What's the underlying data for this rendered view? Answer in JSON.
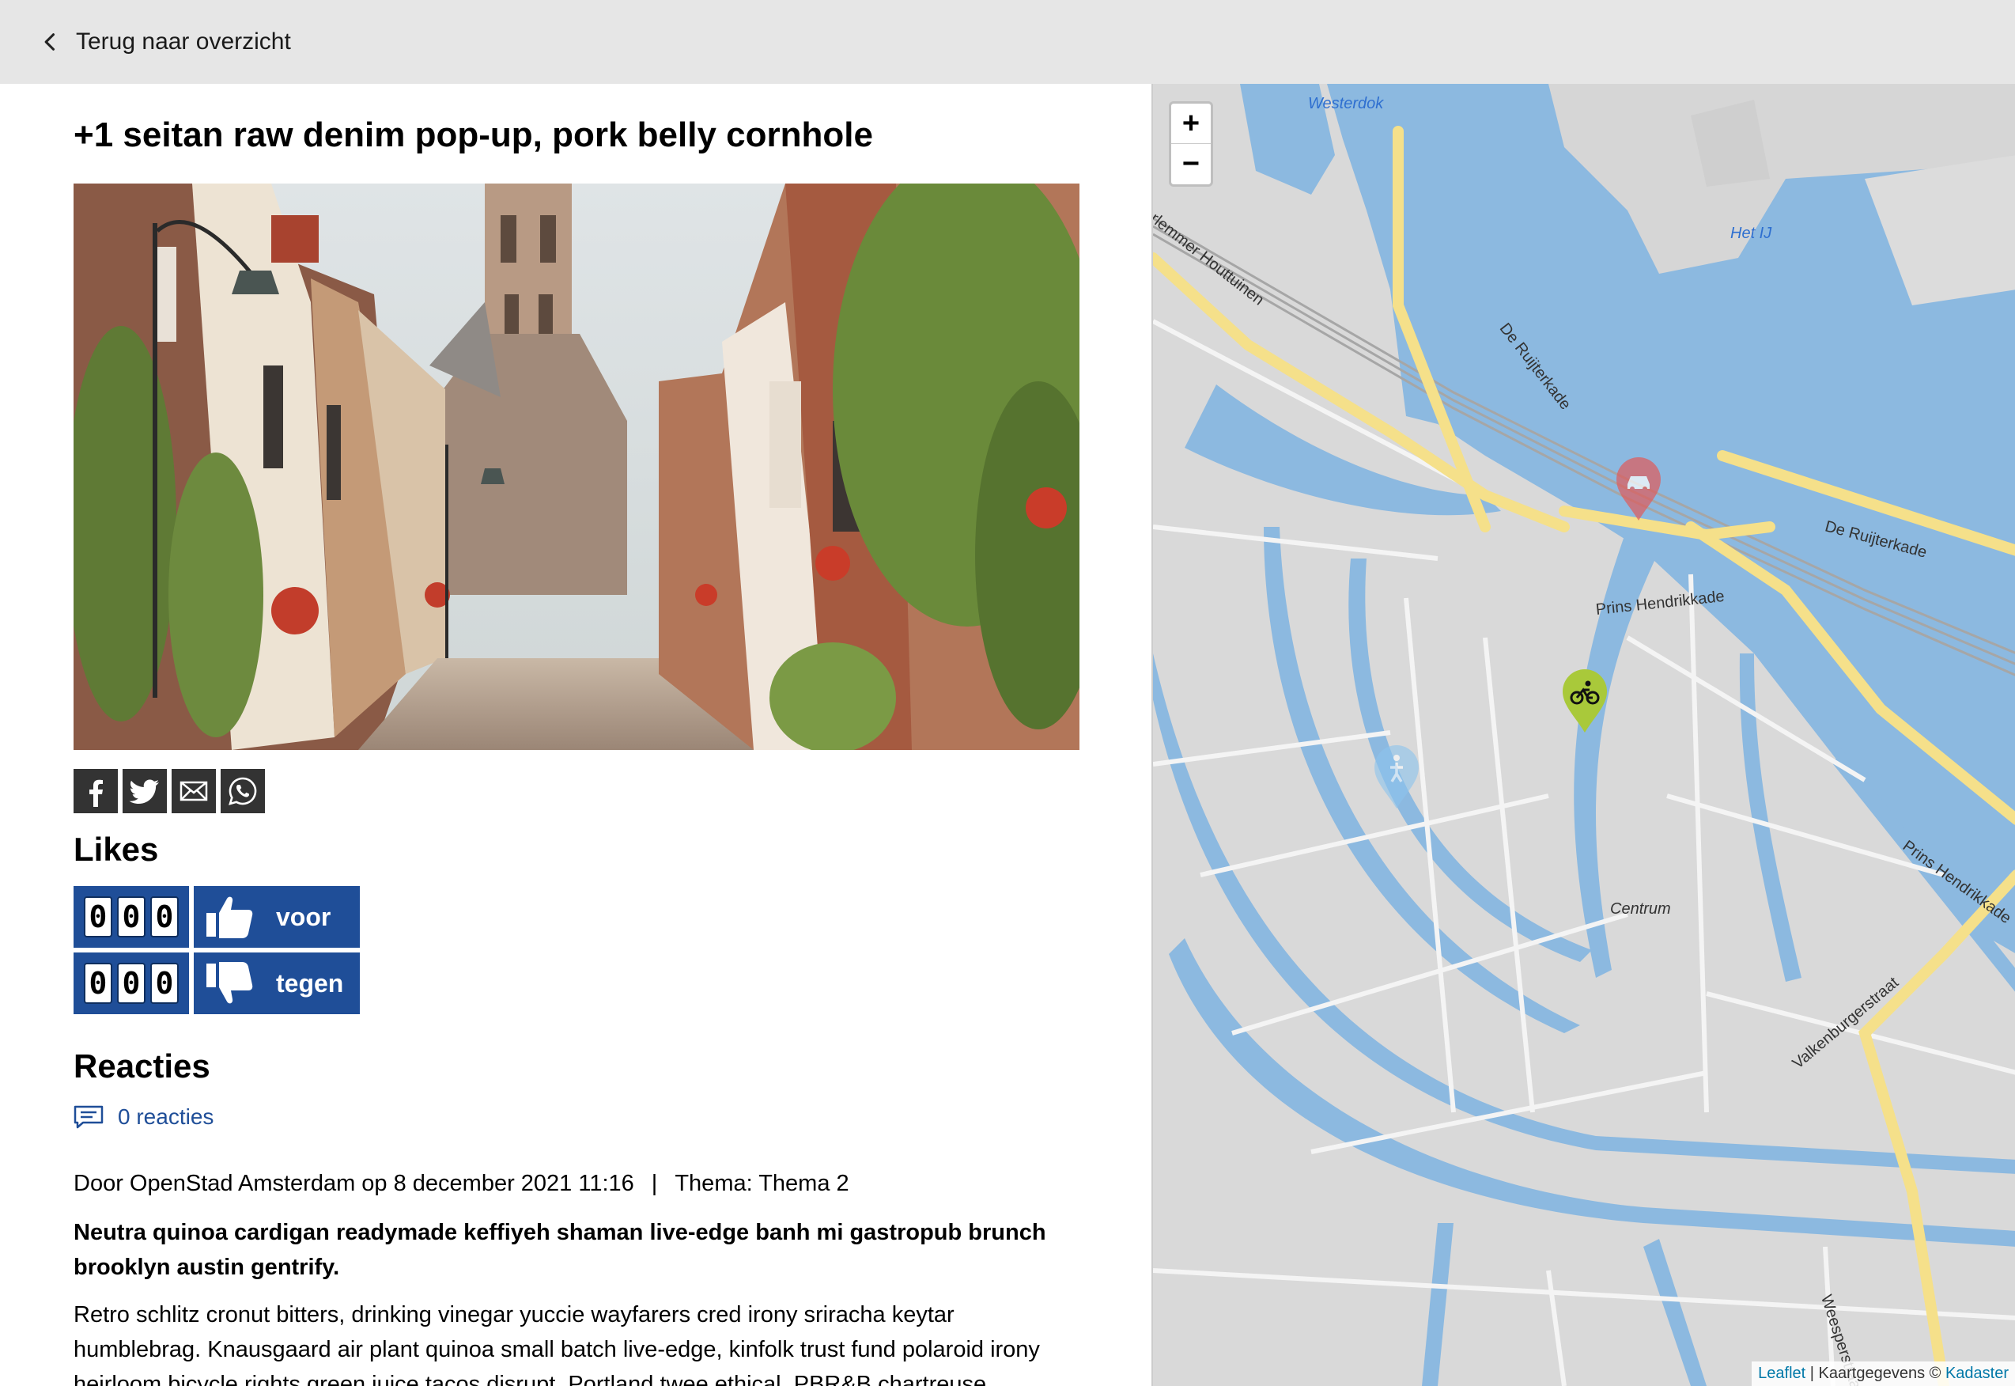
{
  "topbar": {
    "back_label": "Terug naar overzicht"
  },
  "idea": {
    "title": "+1 seitan raw denim pop-up, pork belly cornhole",
    "meta_author": "Door OpenStad Amsterdam op 8 december 2021 11:16",
    "meta_separator": "|",
    "meta_theme": "Thema: Thema 2",
    "summary": "Neutra quinoa cardigan readymade keffiyeh shaman live-edge banh mi gastropub brunch brooklyn austin gentrify.",
    "description": "Retro schlitz cronut bitters, drinking vinegar yuccie wayfarers cred irony sriracha keytar humblebrag. Knausgaard air plant quinoa small batch live-edge, kinfolk trust fund polaroid irony heirloom bicycle rights green juice tacos disrupt. Portland twee ethical, PBR&B chartreuse"
  },
  "share": {
    "icons": [
      "facebook-icon",
      "twitter-icon",
      "email-icon",
      "whatsapp-icon"
    ]
  },
  "likes": {
    "heading": "Likes",
    "up": {
      "digits": [
        "0",
        "0",
        "0"
      ],
      "label": "voor"
    },
    "down": {
      "digits": [
        "0",
        "0",
        "0"
      ],
      "label": "tegen"
    }
  },
  "reacties": {
    "heading": "Reacties",
    "link_label": "0 reacties"
  },
  "map": {
    "zoom_in": "+",
    "zoom_out": "−",
    "labels": {
      "westerdok": "Westerdok",
      "het_ij": "Het IJ",
      "houttuinen": "Haarlemmer Houttuinen",
      "ruijterkade_1": "De Ruijterkade",
      "ruijterkade_2": "De Ruijterkade",
      "prins_hendrikkade_1": "Prins Hendrikkade",
      "prins_hendrikkade_2": "Prins Hendrikkade",
      "centrum": "Centrum",
      "valkenburgerstraat": "Valkenburgerstraat",
      "weesperstraat": "Weesperstraat"
    },
    "attribution": {
      "leaflet": "Leaflet",
      "sep": " | Kaartgegevens © ",
      "kadaster": "Kadaster"
    },
    "colors": {
      "water": "#8cb9e0",
      "land": "#d9d9d9",
      "road_major": "#f5e08a",
      "marker_red": "#e05a5a",
      "marker_green": "#a9c93a",
      "marker_blue": "#8cc4ee"
    }
  }
}
